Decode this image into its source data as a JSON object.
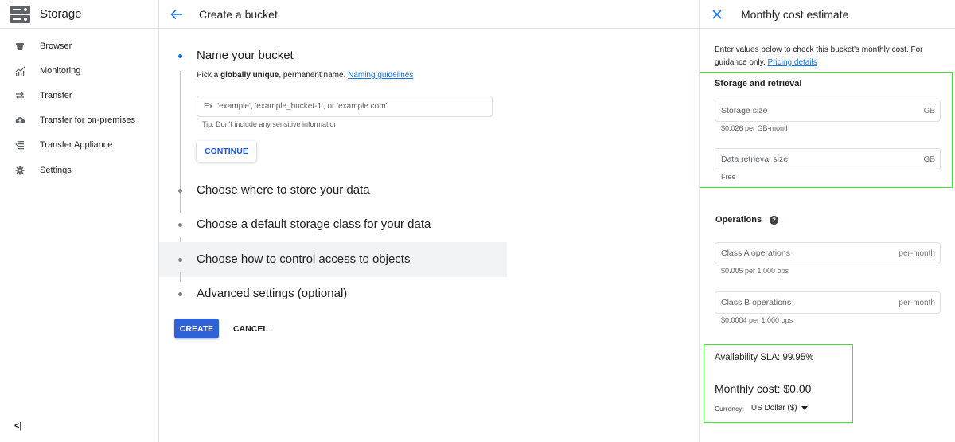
{
  "leftnav": {
    "product_title": "Storage",
    "items": [
      {
        "label": "Browser",
        "icon": "bucket-icon"
      },
      {
        "label": "Monitoring",
        "icon": "chart-icon"
      },
      {
        "label": "Transfer",
        "icon": "transfer-arrows-icon"
      },
      {
        "label": "Transfer for on-premises",
        "icon": "cloud-upload-icon"
      },
      {
        "label": "Transfer Appliance",
        "icon": "list-icon"
      },
      {
        "label": "Settings",
        "icon": "gear-icon"
      }
    ],
    "collapse_label": "<|"
  },
  "main": {
    "title": "Create a bucket",
    "steps": [
      {
        "title": "Name your bucket",
        "desc_prefix": "Pick a ",
        "desc_bold": "globally unique",
        "desc_suffix": ", permanent name. ",
        "link": "Naming guidelines",
        "input_placeholder": "Ex. 'example', 'example_bucket-1', or 'example.com'",
        "input_value": "",
        "tip": "Tip: Don't include any sensitive information",
        "continue_label": "CONTINUE"
      },
      {
        "title": "Choose where to store your data"
      },
      {
        "title": "Choose a default storage class for your data"
      },
      {
        "title": "Choose how to control access to objects"
      },
      {
        "title": "Advanced settings (optional)"
      }
    ],
    "create_label": "CREATE",
    "cancel_label": "CANCEL"
  },
  "panel": {
    "title": "Monthly cost estimate",
    "intro": "Enter values below to check this bucket's monthly cost. For guidance only. ",
    "intro_link": "Pricing details",
    "storage_section": {
      "title": "Storage and retrieval",
      "fields": [
        {
          "label": "Storage size",
          "unit": "GB",
          "hint": "$0.026 per GB-month",
          "value": ""
        },
        {
          "label": "Data retrieval size",
          "unit": "GB",
          "hint": "Free",
          "value": ""
        }
      ]
    },
    "operations_section": {
      "title": "Operations",
      "help": "?",
      "fields": [
        {
          "label": "Class A operations",
          "unit": "per-month",
          "hint": "$0.005 per 1,000 ops",
          "value": ""
        },
        {
          "label": "Class B operations",
          "unit": "per-month",
          "hint": "$0.0004 per 1,000 ops",
          "value": ""
        }
      ]
    },
    "sla": "Availability SLA: 99.95%",
    "monthly_cost": "Monthly cost: $0.00",
    "currency_label": "Currency:",
    "currency_value": "US Dollar ($)"
  },
  "colors": {
    "accent": "#1a73e8",
    "primary_button": "#2e62d9",
    "highlight_box": "#3ee52a"
  }
}
